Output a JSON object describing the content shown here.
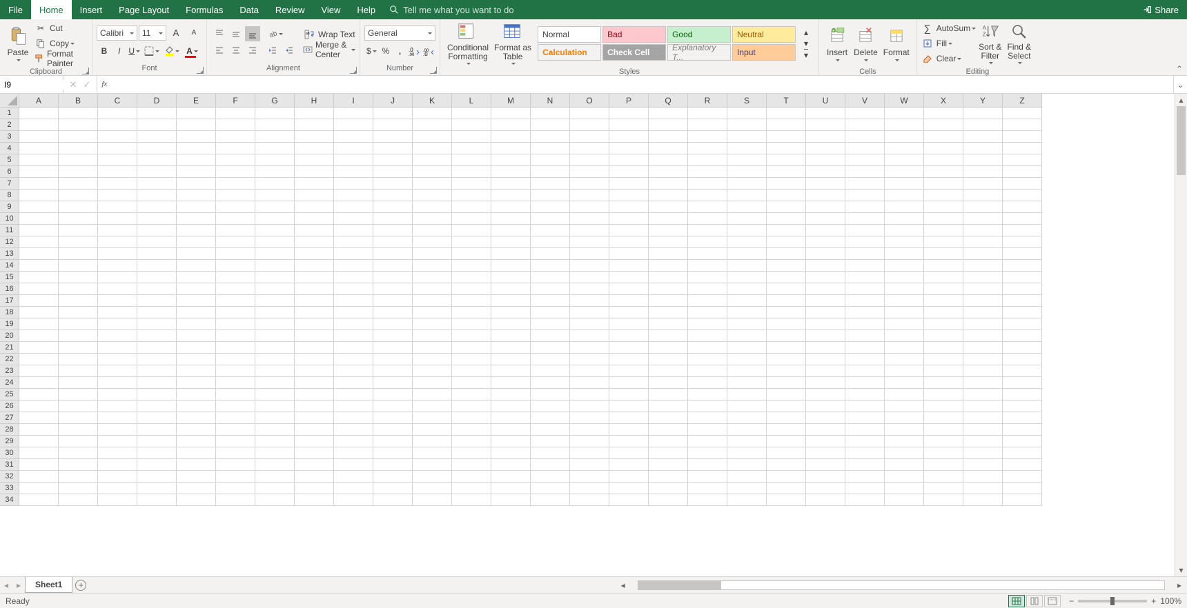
{
  "tabs": [
    "File",
    "Home",
    "Insert",
    "Page Layout",
    "Formulas",
    "Data",
    "Review",
    "View",
    "Help"
  ],
  "active_tab": "Home",
  "tellme_placeholder": "Tell me what you want to do",
  "share": "Share",
  "clipboard": {
    "paste": "Paste",
    "cut": "Cut",
    "copy": "Copy",
    "fp": "Format Painter",
    "label": "Clipboard"
  },
  "font": {
    "name": "Calibri",
    "size": "11",
    "label": "Font"
  },
  "alignment": {
    "wrap": "Wrap Text",
    "merge": "Merge & Center",
    "label": "Alignment"
  },
  "number": {
    "format": "General",
    "label": "Number"
  },
  "styles": {
    "cf": "Conditional\nFormatting",
    "fat": "Format as\nTable",
    "row1": [
      "Normal",
      "Bad",
      "Good",
      "Neutral"
    ],
    "row2": [
      "Calculation",
      "Check Cell",
      "Explanatory T...",
      "Input"
    ],
    "label": "Styles"
  },
  "cells": {
    "insert": "Insert",
    "delete": "Delete",
    "format": "Format",
    "label": "Cells"
  },
  "editing": {
    "autosum": "AutoSum",
    "fill": "Fill",
    "clear": "Clear",
    "sort": "Sort &\nFilter",
    "find": "Find &\nSelect",
    "label": "Editing"
  },
  "namebox": "I9",
  "columns": [
    "A",
    "B",
    "C",
    "D",
    "E",
    "F",
    "G",
    "H",
    "I",
    "J",
    "K",
    "L",
    "M",
    "N",
    "O",
    "P",
    "Q",
    "R",
    "S",
    "T",
    "U",
    "V",
    "W",
    "X",
    "Y",
    "Z"
  ],
  "rows": 34,
  "sheet": "Sheet1",
  "status": "Ready",
  "zoom": "100%"
}
